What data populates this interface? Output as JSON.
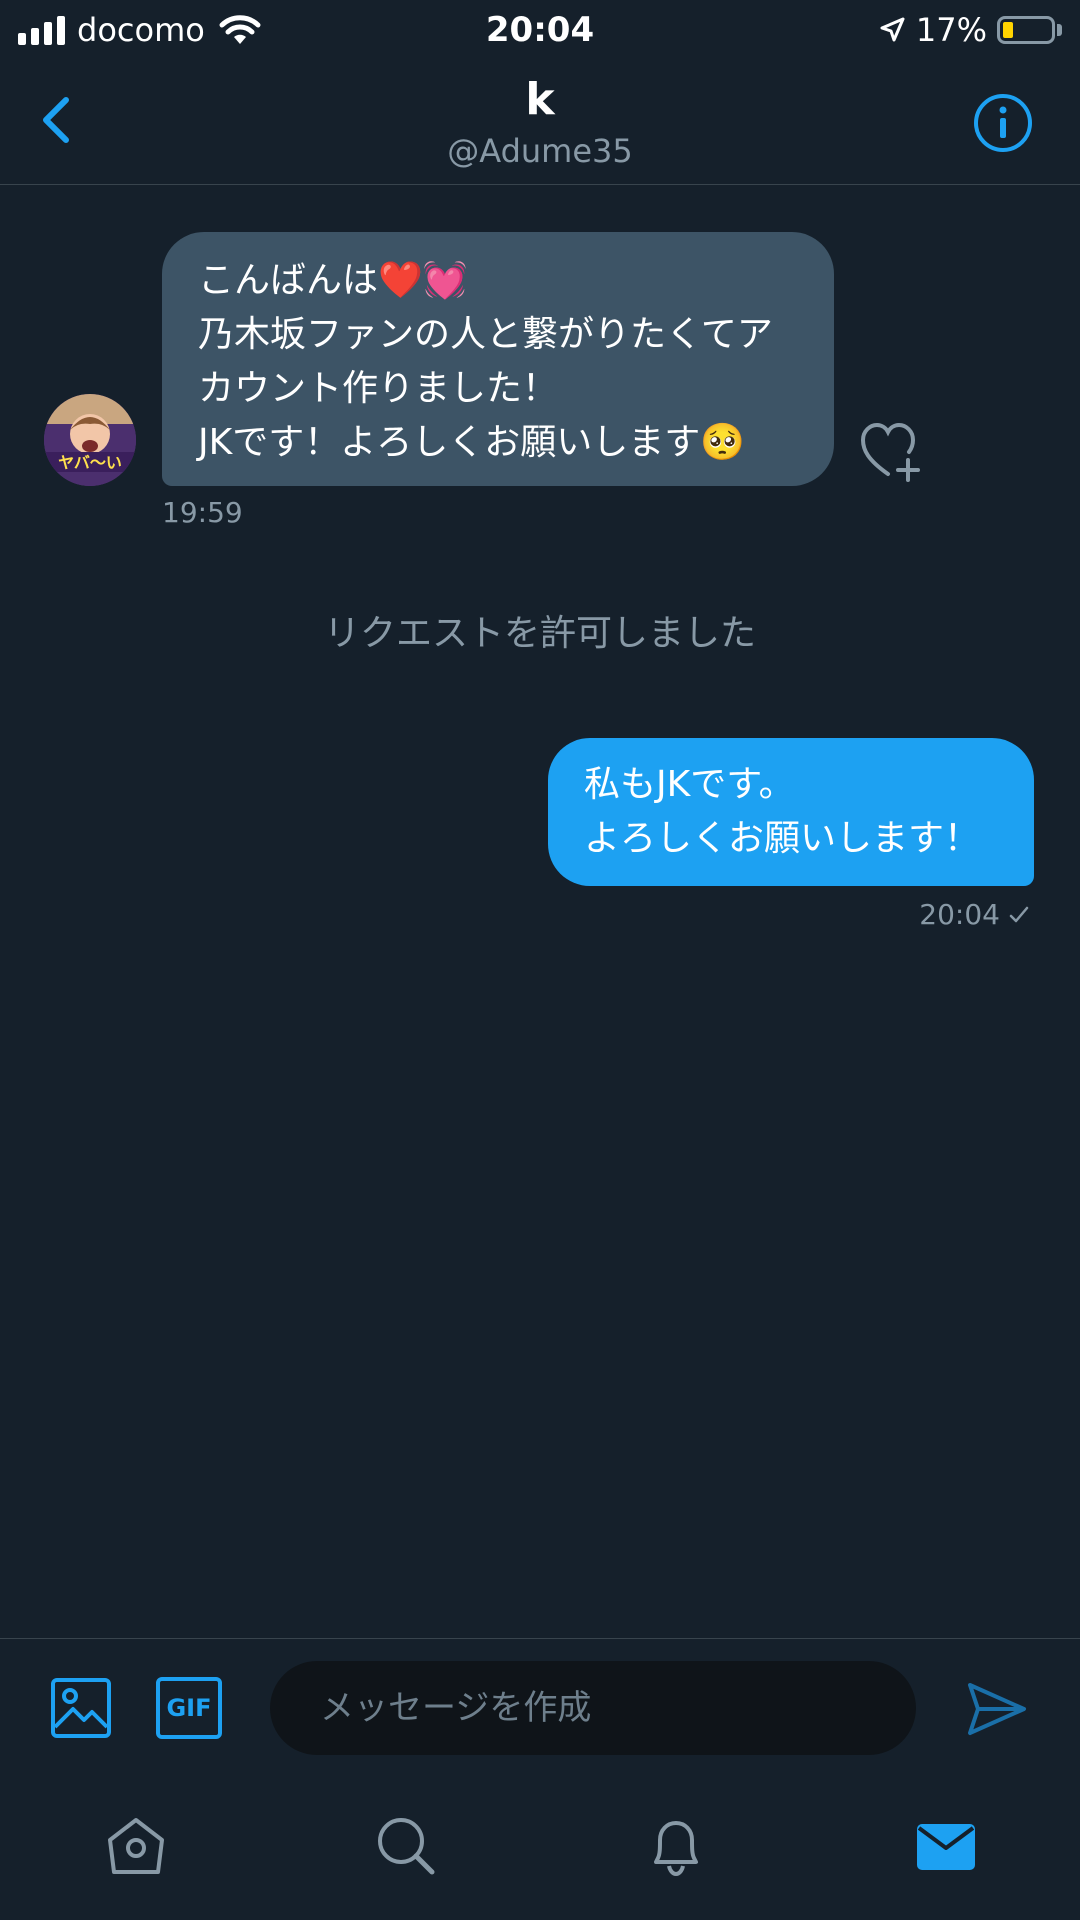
{
  "status_bar": {
    "carrier": "docomo",
    "time": "20:04",
    "battery_percent": "17%",
    "battery_level": 0.17
  },
  "header": {
    "name": "k",
    "handle": "@Adume35"
  },
  "messages": [
    {
      "direction": "incoming",
      "lines": [
        "こんばんは❤️💓",
        "乃木坂ファンの人と繋がりたくてア",
        "カウント作りました！",
        "JKです！よろしくお願いします🥺"
      ],
      "time": "19:59"
    },
    {
      "direction": "system",
      "text": "リクエストを許可しました"
    },
    {
      "direction": "outgoing",
      "lines": [
        "私もJKです。",
        "よろしくお願いします！"
      ],
      "time": "20:04",
      "status_icon": "check-icon"
    }
  ],
  "avatar_caption": "ヤバ〜い",
  "composer": {
    "gif_label": "GIF",
    "placeholder": "メッセージを作成"
  },
  "tabs": [
    "home-icon",
    "search-icon",
    "bell-icon",
    "mail-icon"
  ],
  "colors": {
    "background": "#15202b",
    "accent": "#1da1f2",
    "incoming_bubble": "#3d5466",
    "muted_text": "#8899a6"
  }
}
